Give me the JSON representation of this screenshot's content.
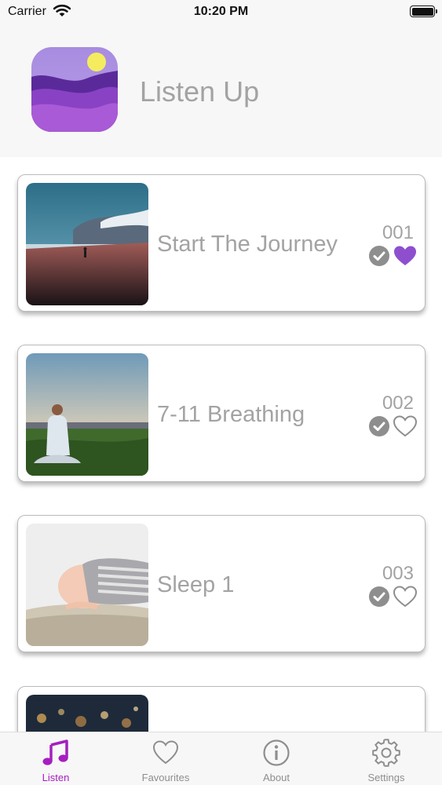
{
  "status_bar": {
    "carrier": "Carrier",
    "time": "10:20 PM"
  },
  "header": {
    "app_title": "Listen Up"
  },
  "colors": {
    "accent": "#a51fbf",
    "heart_filled": "#8e4fcf",
    "text_muted": "#a3a3a3",
    "icon_gray": "#8e8e8e"
  },
  "tracks": [
    {
      "title": "Start The Journey",
      "number": "001",
      "completed": true,
      "favourite": true,
      "image": "beach-walker"
    },
    {
      "title": "7-11 Breathing",
      "number": "002",
      "completed": true,
      "favourite": false,
      "image": "meditation-sunset"
    },
    {
      "title": "Sleep 1",
      "number": "003",
      "completed": true,
      "favourite": false,
      "image": "sleeping-baby"
    },
    {
      "title": "",
      "number": "",
      "completed": false,
      "favourite": false,
      "image": "bokeh-lights"
    }
  ],
  "tab_bar": {
    "tabs": [
      {
        "label": "Listen",
        "icon": "music-note-icon",
        "active": true
      },
      {
        "label": "Favourites",
        "icon": "heart-icon",
        "active": false
      },
      {
        "label": "About",
        "icon": "info-icon",
        "active": false
      },
      {
        "label": "Settings",
        "icon": "gear-icon",
        "active": false
      }
    ]
  }
}
